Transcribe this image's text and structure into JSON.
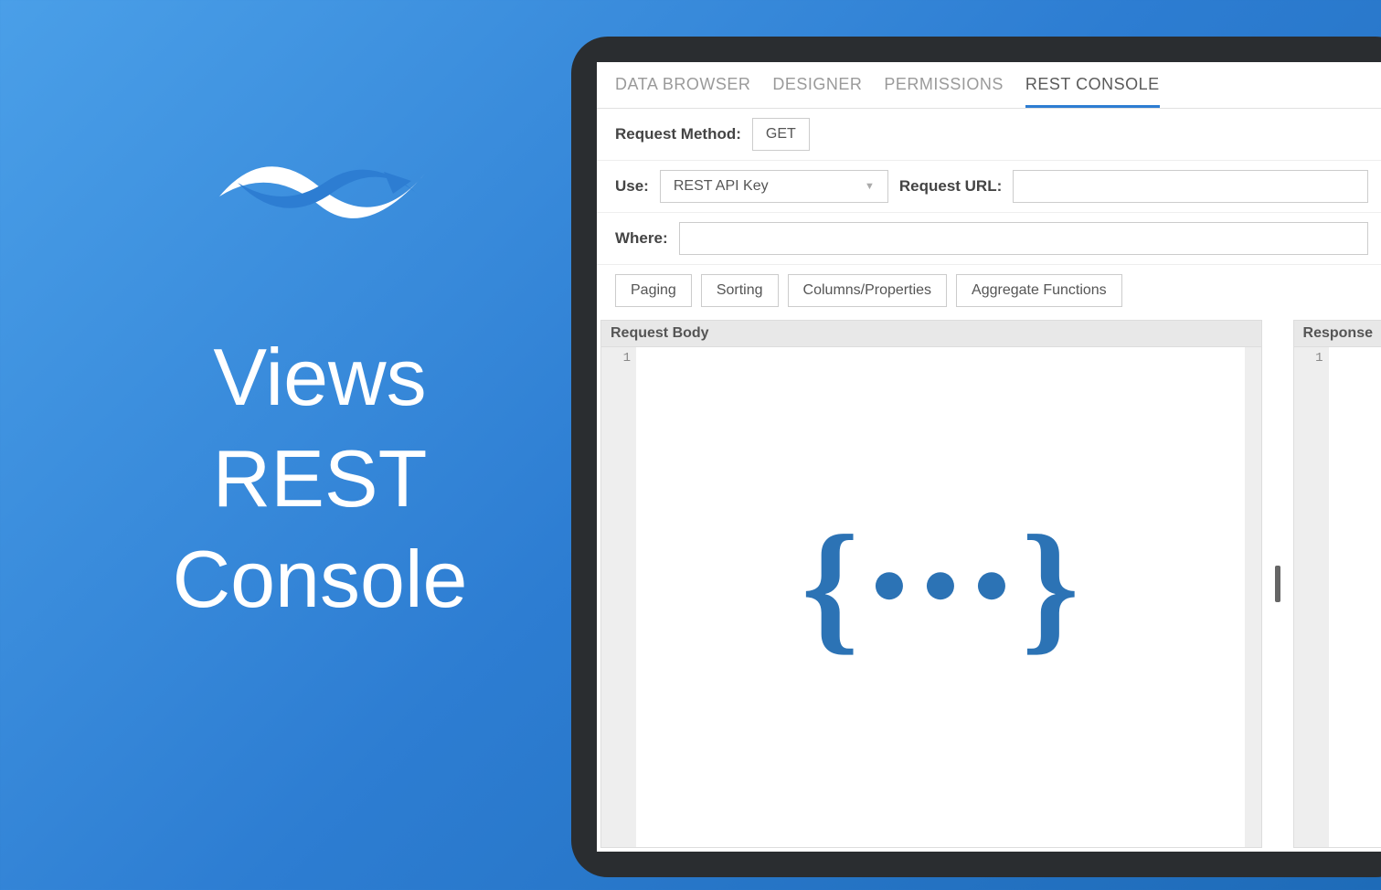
{
  "brand": {
    "line1": "Views",
    "line2": "REST",
    "line3": "Console"
  },
  "tabs": [
    {
      "label": "DATA BROWSER",
      "active": false
    },
    {
      "label": "DESIGNER",
      "active": false
    },
    {
      "label": "PERMISSIONS",
      "active": false
    },
    {
      "label": "REST CONSOLE",
      "active": true
    }
  ],
  "form": {
    "request_method_label": "Request Method:",
    "request_method_value": "GET",
    "use_label": "Use:",
    "use_value": "REST API Key",
    "request_url_label": "Request URL:",
    "request_url_value": "",
    "where_label": "Where:",
    "where_value": ""
  },
  "option_buttons": [
    "Paging",
    "Sorting",
    "Columns/Properties",
    "Aggregate Functions"
  ],
  "panes": {
    "left": {
      "header": "Request Body",
      "line_start": "1"
    },
    "right": {
      "header": "Response",
      "line_start": "1"
    }
  }
}
